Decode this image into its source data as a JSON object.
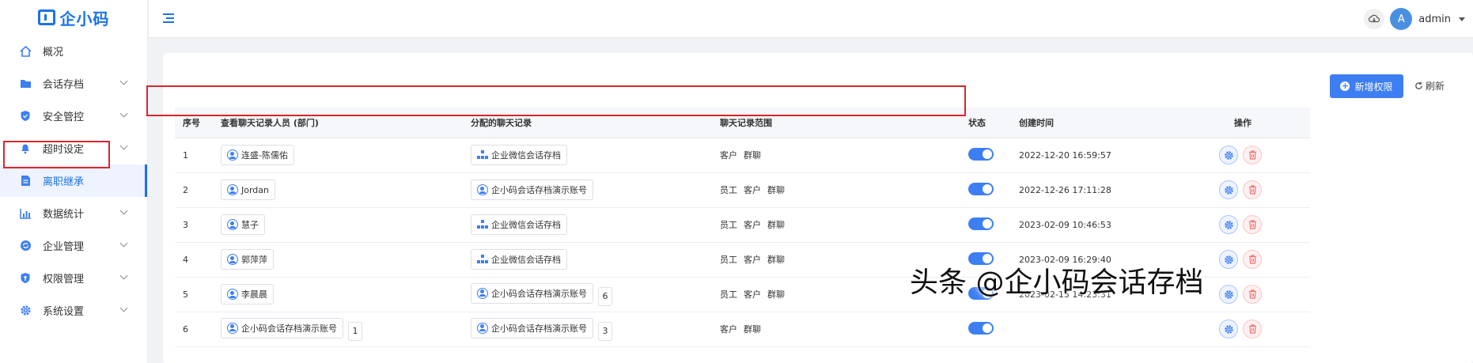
{
  "app": {
    "logo_text": "企小码"
  },
  "sidebar": {
    "items": [
      {
        "label": "概况",
        "icon": "home-icon",
        "chevron": false
      },
      {
        "label": "会话存档",
        "icon": "folder-icon",
        "chevron": true
      },
      {
        "label": "安全管控",
        "icon": "shield-icon",
        "chevron": true
      },
      {
        "label": "超时设定",
        "icon": "bell-icon",
        "chevron": true
      },
      {
        "label": "离职继承",
        "icon": "document-icon",
        "chevron": false,
        "active": true
      },
      {
        "label": "数据统计",
        "icon": "bar-chart-icon",
        "chevron": true
      },
      {
        "label": "企业管理",
        "icon": "sync-icon",
        "chevron": true
      },
      {
        "label": "权限管理",
        "icon": "shield-key-icon",
        "chevron": true
      },
      {
        "label": "系统设置",
        "icon": "gear-icon",
        "chevron": true
      }
    ]
  },
  "header": {
    "user": {
      "avatar_letter": "A",
      "name": "admin"
    }
  },
  "toolbar": {
    "add_label": "新增权限",
    "refresh_label": "刷新"
  },
  "table": {
    "headers": [
      "序号",
      "查看聊天记录人员 (部门)",
      "分配的聊天记录",
      "聊天记录范围",
      "状态",
      "创建时间",
      "操作"
    ],
    "rows": [
      {
        "no": "1",
        "viewer": "连盛-陈儒佑",
        "viewer_icon": "user-icon",
        "viewer_count": "",
        "assigned": "企业微信会话存档",
        "assigned_icon": "org-icon",
        "assigned_count": "",
        "scope": [
          "客户",
          "群聊"
        ],
        "enabled": true,
        "created": "2022-12-20 16:59:57"
      },
      {
        "no": "2",
        "viewer": "Jordan",
        "viewer_icon": "user-icon",
        "viewer_count": "",
        "assigned": "企小码会话存档演示账号",
        "assigned_icon": "user-icon",
        "assigned_count": "",
        "scope": [
          "员工",
          "客户",
          "群聊"
        ],
        "enabled": true,
        "created": "2022-12-26 17:11:28"
      },
      {
        "no": "3",
        "viewer": "慧子",
        "viewer_icon": "user-icon",
        "viewer_count": "",
        "assigned": "企业微信会话存档",
        "assigned_icon": "org-icon",
        "assigned_count": "",
        "scope": [
          "员工",
          "客户",
          "群聊"
        ],
        "enabled": true,
        "created": "2023-02-09 10:46:53"
      },
      {
        "no": "4",
        "viewer": "郭萍萍",
        "viewer_icon": "user-icon",
        "viewer_count": "",
        "assigned": "企业微信会话存档",
        "assigned_icon": "org-icon",
        "assigned_count": "",
        "scope": [
          "员工",
          "客户",
          "群聊"
        ],
        "enabled": true,
        "created": "2023-02-09 16:29:40"
      },
      {
        "no": "5",
        "viewer": "李晨晨",
        "viewer_icon": "user-icon",
        "viewer_count": "",
        "assigned": "企小码会话存档演示账号",
        "assigned_icon": "user-icon",
        "assigned_count": "6",
        "scope": [
          "员工",
          "客户",
          "群聊"
        ],
        "enabled": true,
        "created": "2023-02-15 14:23:31"
      },
      {
        "no": "6",
        "viewer": "企小码会话存档演示账号",
        "viewer_icon": "user-icon",
        "viewer_count": "1",
        "assigned": "企小码会话存档演示账号",
        "assigned_icon": "user-icon",
        "assigned_count": "3",
        "scope": [
          "客户",
          "群聊"
        ],
        "enabled": true,
        "created": ""
      }
    ]
  },
  "watermark": "头条 @企小码会话存档",
  "colors": {
    "accent": "#3d7ff3",
    "highlight": "#d9262c",
    "danger": "#f56c6c"
  }
}
